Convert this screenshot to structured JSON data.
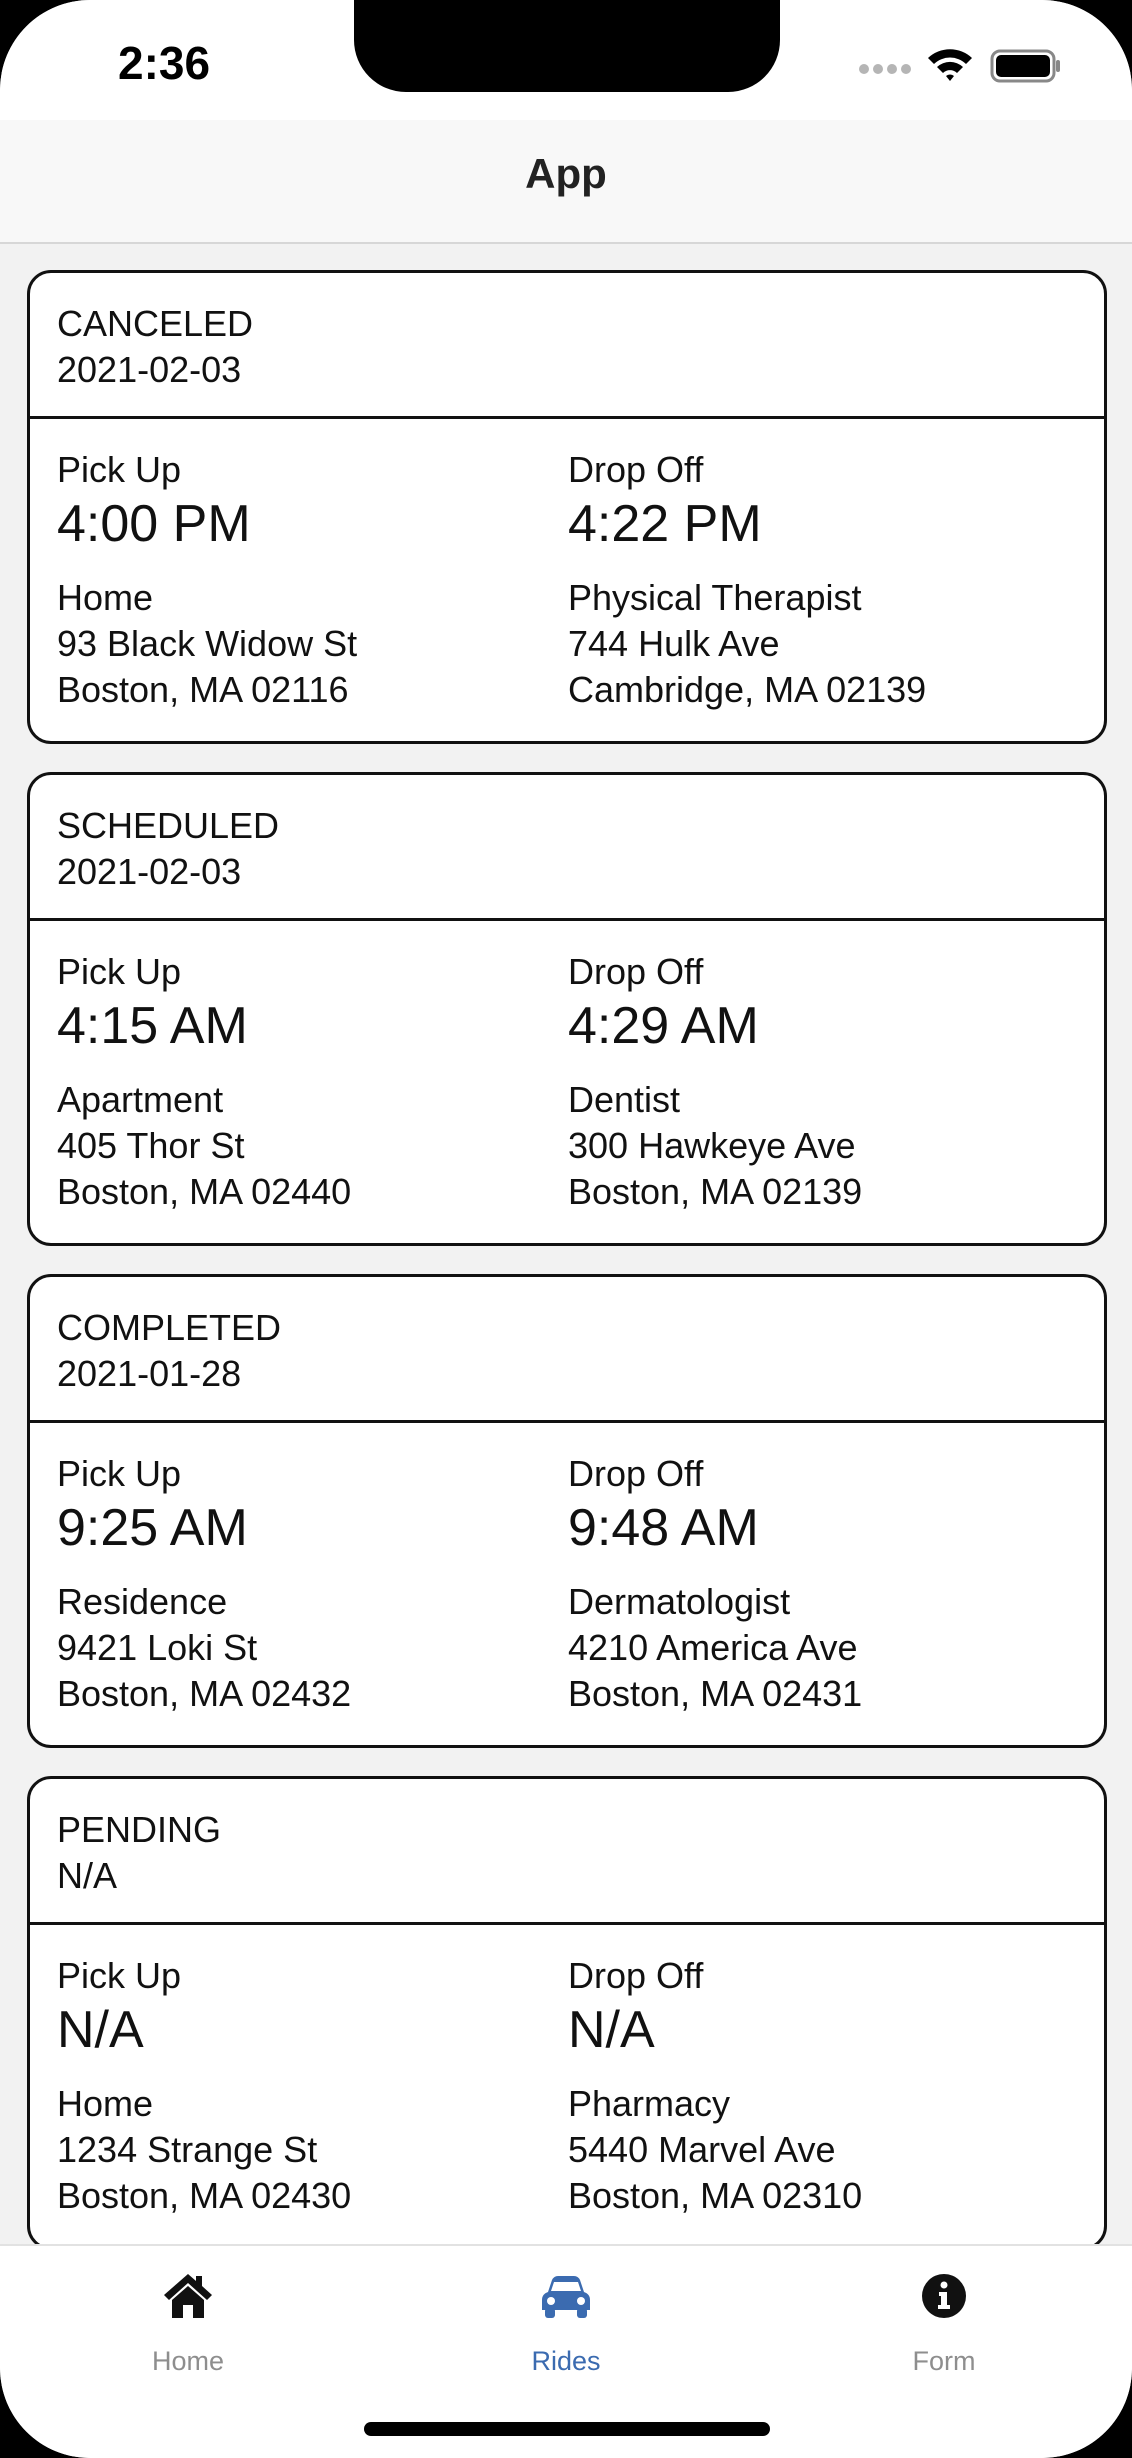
{
  "status_bar": {
    "time": "2:36"
  },
  "nav": {
    "title": "App"
  },
  "rides": [
    {
      "status": "CANCELED",
      "date": "2021-02-03",
      "pickup": {
        "label": "Pick Up",
        "time": "4:00 PM",
        "place": "Home",
        "street": "93 Black Widow St",
        "city": "Boston, MA 02116"
      },
      "dropoff": {
        "label": "Drop Off",
        "time": "4:22 PM",
        "place": "Physical Therapist",
        "street": "744 Hulk Ave",
        "city": "Cambridge, MA 02139"
      }
    },
    {
      "status": "SCHEDULED",
      "date": "2021-02-03",
      "pickup": {
        "label": "Pick Up",
        "time": "4:15 AM",
        "place": "Apartment",
        "street": "405 Thor St",
        "city": "Boston, MA 02440"
      },
      "dropoff": {
        "label": "Drop Off",
        "time": "4:29 AM",
        "place": "Dentist",
        "street": "300 Hawkeye Ave",
        "city": "Boston, MA 02139"
      }
    },
    {
      "status": "COMPLETED",
      "date": "2021-01-28",
      "pickup": {
        "label": "Pick Up",
        "time": "9:25 AM",
        "place": "Residence",
        "street": "9421 Loki St",
        "city": "Boston, MA 02432"
      },
      "dropoff": {
        "label": "Drop Off",
        "time": "9:48 AM",
        "place": "Dermatologist",
        "street": "4210 America Ave",
        "city": "Boston, MA 02431"
      }
    },
    {
      "status": "PENDING",
      "date": "N/A",
      "pickup": {
        "label": "Pick Up",
        "time": "N/A",
        "place": "Home",
        "street": "1234 Strange St",
        "city": "Boston, MA 02430"
      },
      "dropoff": {
        "label": "Drop Off",
        "time": "N/A",
        "place": "Pharmacy",
        "street": "5440 Marvel Ave",
        "city": "Boston, MA 02310"
      }
    }
  ],
  "tab_bar": {
    "items": [
      {
        "label": "Home",
        "icon": "home-icon",
        "active": false
      },
      {
        "label": "Rides",
        "icon": "car-icon",
        "active": true
      },
      {
        "label": "Form",
        "icon": "info-icon",
        "active": false
      }
    ],
    "active_color": "#3b6bb0",
    "inactive_color": "#8e8e8e"
  }
}
